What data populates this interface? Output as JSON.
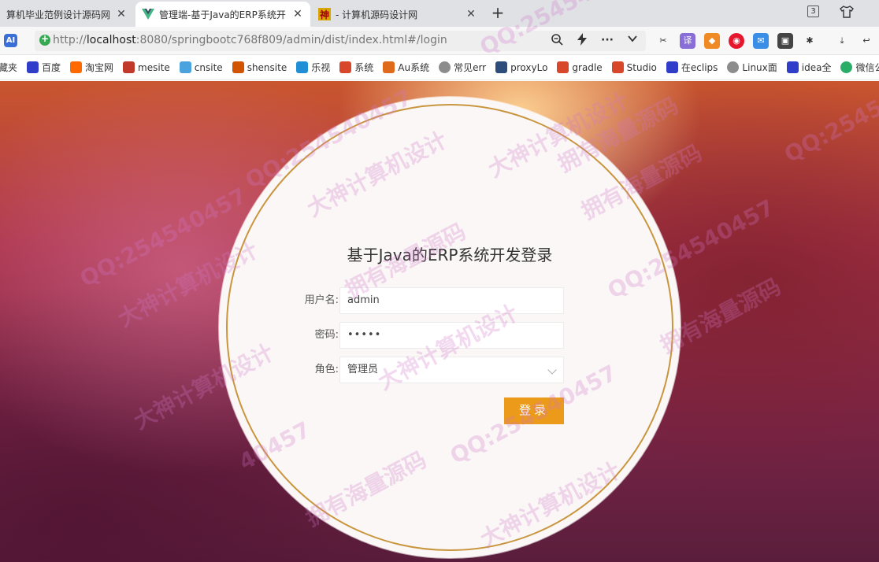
{
  "tabs": [
    {
      "label": "算机毕业范例设计源码网",
      "close": "✕"
    },
    {
      "label": "管理端-基于Java的ERP系统开",
      "close": "✕"
    },
    {
      "label": "- 计算机源码设计网",
      "close": "✕"
    }
  ],
  "newtab_label": "+",
  "tab_count": "3",
  "ai_label": "AI",
  "url": {
    "scheme": "http://",
    "host": "localhost",
    "rest": ":8080/springbootc768f809/admin/dist/index.html#/login"
  },
  "bookmarks": [
    {
      "label": "藏夹",
      "icon": "star-icon",
      "color": "#ffffff"
    },
    {
      "label": "百度",
      "icon": "baidu-icon",
      "color": "#2f3dc9"
    },
    {
      "label": "淘宝网",
      "icon": "taobao-icon",
      "color": "#ff6a00"
    },
    {
      "label": "mesite",
      "icon": "mesite-icon",
      "color": "#c0392b"
    },
    {
      "label": "cnsite",
      "icon": "cnsite-icon",
      "color": "#4aa3df"
    },
    {
      "label": "shensite",
      "icon": "shensite-icon",
      "color": "#d35400"
    },
    {
      "label": "乐视",
      "icon": "tv-icon",
      "color": "#1f8fd6"
    },
    {
      "label": "系统",
      "icon": "system-icon",
      "color": "#d9472b"
    },
    {
      "label": "Au系统",
      "icon": "au-icon",
      "color": "#e06a1b"
    },
    {
      "label": "常见err",
      "icon": "globe-icon",
      "color": "#8c8c8c"
    },
    {
      "label": "proxyLo",
      "icon": "proxy-icon",
      "color": "#2f4d7a"
    },
    {
      "label": "gradle",
      "icon": "gradle-icon",
      "color": "#d9472b"
    },
    {
      "label": "Studio",
      "icon": "studio-icon",
      "color": "#d9472b"
    },
    {
      "label": "在eclips",
      "icon": "baidu-icon",
      "color": "#2f3dc9"
    },
    {
      "label": "Linux面",
      "icon": "globe-icon",
      "color": "#8c8c8c"
    },
    {
      "label": "idea全",
      "icon": "baidu-icon",
      "color": "#2f3dc9"
    },
    {
      "label": "微信公",
      "icon": "wechat-icon",
      "color": "#2aae67"
    }
  ],
  "login": {
    "title": "基于Java的ERP系统开发登录",
    "username_label": "用户名:",
    "username_value": "admin",
    "password_label": "密码:",
    "password_value": "•••••",
    "role_label": "角色:",
    "role_value": "管理员",
    "submit_label": "登录"
  },
  "watermarks": [
    "QQ:2545404",
    "大神计算机设计",
    "拥有海量源码",
    "QQ:254540457",
    "大神计算机设计",
    "拥有海量源码",
    "QQ:254540457",
    "大神计算机设计",
    "拥有海量源码",
    "QQ:254540457",
    "大神计算机设计",
    "大神计算机设计",
    "拥有海量源码",
    "QQ:254540457",
    "拥有海量源码",
    "40457",
    "大神计算机设计",
    "QQ:2545"
  ],
  "colors": {
    "accent": "#ec9a1a",
    "ring": "#c9963f"
  }
}
